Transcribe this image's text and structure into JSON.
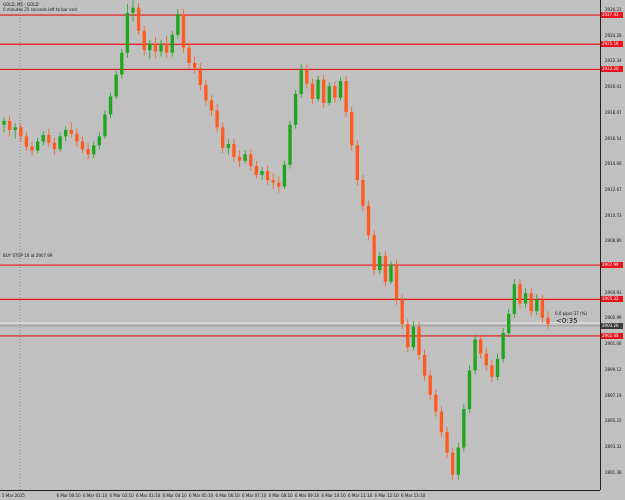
{
  "header": {
    "symbol": "GOLD, M5 : GOLD",
    "timer": "0 minutes 25 seconds left to bar end"
  },
  "order_label": "BUY STOP 10 at 2907.99",
  "current_note": "0.0 pips/-37 (%)",
  "countdown": "<0:35",
  "colors": {
    "background": "#c0c0c0",
    "bull": "#1fa51f",
    "bear": "#ff5a1f",
    "level_line": "#e8141c",
    "bid_line": "#8c8c8c",
    "ask_line": "#ffffff"
  },
  "y_axis_labels": [
    "2926.21",
    "2924.28",
    "2922.34",
    "2920.41",
    "2918.47",
    "2916.54",
    "2914.60",
    "2912.67",
    "2910.73",
    "2908.80",
    "2906.86",
    "2904.93",
    "2902.99",
    "2901.06",
    "2899.12",
    "2897.19",
    "2895.25",
    "2893.32",
    "2891.38"
  ],
  "x_axis_labels": [
    "5 Mar 2025",
    "6 Mar 00:10",
    "6 Mar 01:10",
    "6 Mar 02:10",
    "6 Mar 03:10",
    "6 Mar 04:10",
    "6 Mar 05:10",
    "6 Mar 06:10",
    "6 Mar 07:10",
    "6 Mar 08:10",
    "6 Mar 09:10",
    "6 Mar 10:10",
    "6 Mar 11:10",
    "6 Mar 12:10",
    "6 Mar 13:10"
  ],
  "level_tags": [
    "2927.43",
    "2925.16",
    "2923.20",
    "2907.99",
    "2905.32",
    "2903.26",
    "2902.48"
  ],
  "chart_data": {
    "type": "candlestick",
    "symbol": "GOLD",
    "timeframe": "M5",
    "y_range": [
      2890.5,
      2928.6
    ],
    "horizontal_lines": [
      {
        "price": 2927.43,
        "style": "level"
      },
      {
        "price": 2925.16,
        "style": "level"
      },
      {
        "price": 2923.2,
        "style": "level"
      },
      {
        "price": 2907.99,
        "style": "level"
      },
      {
        "price": 2905.32,
        "style": "level"
      },
      {
        "price": 2903.26,
        "style": "bid"
      },
      {
        "price": 2902.48,
        "style": "level"
      }
    ],
    "candles": [
      [
        2918.9,
        2919.5,
        2918.3,
        2919.2
      ],
      [
        2919.2,
        2919.6,
        2918.0,
        2918.5
      ],
      [
        2918.5,
        2919.0,
        2917.8,
        2918.7
      ],
      [
        2918.7,
        2919.0,
        2917.6,
        2918.0
      ],
      [
        2918.0,
        2918.3,
        2916.9,
        2917.2
      ],
      [
        2917.2,
        2917.6,
        2916.5,
        2916.9
      ],
      [
        2916.9,
        2917.9,
        2916.7,
        2917.6
      ],
      [
        2917.6,
        2918.4,
        2917.3,
        2918.1
      ],
      [
        2918.1,
        2918.6,
        2917.2,
        2917.5
      ],
      [
        2917.5,
        2917.9,
        2916.6,
        2917.0
      ],
      [
        2917.0,
        2918.3,
        2916.8,
        2918.0
      ],
      [
        2918.0,
        2918.8,
        2917.6,
        2918.5
      ],
      [
        2918.5,
        2919.1,
        2917.9,
        2918.2
      ],
      [
        2918.2,
        2918.6,
        2917.2,
        2917.6
      ],
      [
        2917.6,
        2918.0,
        2916.7,
        2917.0
      ],
      [
        2917.0,
        2917.5,
        2916.2,
        2916.6
      ],
      [
        2916.6,
        2917.6,
        2916.3,
        2917.3
      ],
      [
        2917.3,
        2918.3,
        2917.0,
        2918.0
      ],
      [
        2918.0,
        2920.0,
        2917.8,
        2919.7
      ],
      [
        2919.7,
        2921.4,
        2919.4,
        2921.1
      ],
      [
        2921.1,
        2923.1,
        2920.9,
        2922.8
      ],
      [
        2922.8,
        2924.8,
        2922.5,
        2924.5
      ],
      [
        2924.5,
        2928.3,
        2924.1,
        2927.6
      ],
      [
        2927.6,
        2928.6,
        2926.9,
        2928.0
      ],
      [
        2928.0,
        2928.4,
        2925.9,
        2926.2
      ],
      [
        2926.2,
        2926.6,
        2924.3,
        2924.7
      ],
      [
        2924.7,
        2925.5,
        2924.0,
        2925.2
      ],
      [
        2925.2,
        2925.7,
        2924.1,
        2924.6
      ],
      [
        2924.6,
        2925.5,
        2924.2,
        2925.2
      ],
      [
        2925.2,
        2925.8,
        2924.1,
        2924.5
      ],
      [
        2924.5,
        2926.2,
        2924.2,
        2925.9
      ],
      [
        2925.9,
        2927.9,
        2925.6,
        2927.5
      ],
      [
        2927.5,
        2927.9,
        2924.5,
        2924.9
      ],
      [
        2924.9,
        2925.3,
        2923.3,
        2923.7
      ],
      [
        2923.7,
        2924.2,
        2922.9,
        2923.3
      ],
      [
        2923.3,
        2923.7,
        2921.6,
        2922.0
      ],
      [
        2922.0,
        2922.4,
        2920.4,
        2920.8
      ],
      [
        2920.8,
        2921.2,
        2919.6,
        2920.0
      ],
      [
        2920.0,
        2920.5,
        2918.3,
        2918.7
      ],
      [
        2918.7,
        2919.1,
        2916.7,
        2917.1
      ],
      [
        2917.1,
        2917.8,
        2916.6,
        2917.4
      ],
      [
        2917.4,
        2917.8,
        2916.0,
        2916.4
      ],
      [
        2916.4,
        2916.9,
        2915.6,
        2916.1
      ],
      [
        2916.1,
        2916.9,
        2915.9,
        2916.6
      ],
      [
        2916.6,
        2917.0,
        2915.3,
        2915.7
      ],
      [
        2915.7,
        2916.1,
        2914.7,
        2915.0
      ],
      [
        2915.0,
        2915.6,
        2914.6,
        2915.3
      ],
      [
        2915.3,
        2915.7,
        2914.2,
        2914.6
      ],
      [
        2914.6,
        2915.1,
        2913.9,
        2914.4
      ],
      [
        2914.4,
        2914.9,
        2913.6,
        2914.1
      ],
      [
        2914.1,
        2916.1,
        2913.9,
        2915.8
      ],
      [
        2915.8,
        2919.2,
        2915.5,
        2918.9
      ],
      [
        2918.9,
        2921.6,
        2918.6,
        2921.3
      ],
      [
        2921.3,
        2923.6,
        2921.0,
        2923.2
      ],
      [
        2923.2,
        2923.6,
        2921.7,
        2922.1
      ],
      [
        2922.1,
        2922.5,
        2920.5,
        2920.9
      ],
      [
        2920.9,
        2922.7,
        2920.7,
        2922.4
      ],
      [
        2922.4,
        2922.8,
        2920.2,
        2920.6
      ],
      [
        2920.6,
        2922.2,
        2920.4,
        2921.9
      ],
      [
        2921.9,
        2922.3,
        2920.6,
        2921.0
      ],
      [
        2921.0,
        2922.6,
        2920.8,
        2922.3
      ],
      [
        2922.3,
        2922.7,
        2919.5,
        2919.9
      ],
      [
        2919.9,
        2920.3,
        2916.9,
        2917.3
      ],
      [
        2917.3,
        2917.7,
        2914.2,
        2914.6
      ],
      [
        2914.6,
        2915.0,
        2912.2,
        2912.6
      ],
      [
        2912.6,
        2913.0,
        2909.9,
        2910.3
      ],
      [
        2910.3,
        2910.7,
        2907.2,
        2907.6
      ],
      [
        2907.6,
        2909.0,
        2907.3,
        2908.7
      ],
      [
        2908.7,
        2909.1,
        2906.3,
        2906.7
      ],
      [
        2906.7,
        2908.3,
        2906.5,
        2908.0
      ],
      [
        2908.0,
        2908.4,
        2904.9,
        2905.3
      ],
      [
        2905.3,
        2905.7,
        2903.0,
        2903.4
      ],
      [
        2903.4,
        2903.8,
        2901.2,
        2901.6
      ],
      [
        2901.6,
        2903.6,
        2901.4,
        2903.2
      ],
      [
        2903.2,
        2903.6,
        2900.6,
        2901.0
      ],
      [
        2901.0,
        2901.4,
        2899.0,
        2899.4
      ],
      [
        2899.4,
        2899.8,
        2897.5,
        2897.9
      ],
      [
        2897.9,
        2898.3,
        2896.2,
        2896.6
      ],
      [
        2896.6,
        2897.0,
        2894.6,
        2895.0
      ],
      [
        2895.0,
        2895.4,
        2893.0,
        2893.4
      ],
      [
        2893.4,
        2893.8,
        2891.3,
        2891.7
      ],
      [
        2891.7,
        2894.2,
        2891.3,
        2893.8
      ],
      [
        2893.8,
        2897.2,
        2893.5,
        2896.8
      ],
      [
        2896.8,
        2900.2,
        2896.5,
        2899.8
      ],
      [
        2899.8,
        2902.6,
        2899.5,
        2902.2
      ],
      [
        2902.2,
        2902.6,
        2900.7,
        2901.1
      ],
      [
        2901.1,
        2901.5,
        2899.8,
        2900.2
      ],
      [
        2900.2,
        2900.6,
        2898.9,
        2899.3
      ],
      [
        2899.3,
        2901.1,
        2899.0,
        2900.7
      ],
      [
        2900.7,
        2903.1,
        2900.4,
        2902.7
      ],
      [
        2902.7,
        2904.6,
        2902.4,
        2904.2
      ],
      [
        2904.2,
        2906.9,
        2903.9,
        2906.5
      ],
      [
        2906.5,
        2906.9,
        2904.6,
        2905.0
      ],
      [
        2905.0,
        2906.2,
        2904.7,
        2905.8
      ],
      [
        2905.8,
        2906.2,
        2904.0,
        2904.4
      ],
      [
        2904.4,
        2905.7,
        2904.1,
        2905.3
      ],
      [
        2905.3,
        2905.7,
        2903.5,
        2903.9
      ],
      [
        2903.9,
        2904.4,
        2903.0,
        2903.4
      ]
    ]
  }
}
